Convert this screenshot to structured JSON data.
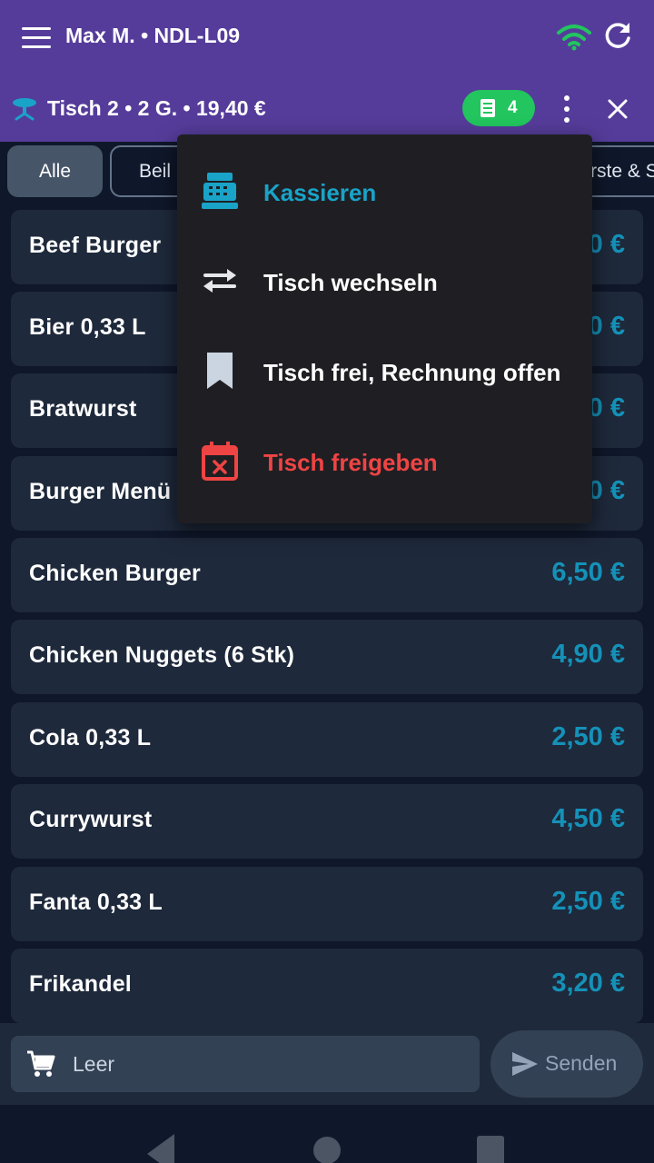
{
  "header": {
    "title": "Max M. • NDL-L09",
    "table_info": "Tisch 2 • 2 G. • 19,40 €",
    "open_orders_count": "4",
    "icons": [
      "menu-icon",
      "wifi-icon",
      "refresh-icon",
      "table-icon",
      "receipt-icon",
      "more-vertical-icon",
      "close-icon"
    ]
  },
  "categories": {
    "items": [
      "Alle",
      "Beil",
      "rste & S"
    ],
    "active": "Alle"
  },
  "products": [
    {
      "name": "Beef Burger",
      "price": "0 €"
    },
    {
      "name": "Bier 0,33 L",
      "price": "0 €"
    },
    {
      "name": "Bratwurst",
      "price": "0 €"
    },
    {
      "name": "Burger Menü",
      "price": "0 €"
    },
    {
      "name": "Chicken Burger",
      "price": "6,50 €"
    },
    {
      "name": "Chicken Nuggets (6 Stk)",
      "price": "4,90 €"
    },
    {
      "name": "Cola 0,33 L",
      "price": "2,50 €"
    },
    {
      "name": "Currywurst",
      "price": "4,50 €"
    },
    {
      "name": "Fanta 0,33 L",
      "price": "2,50 €"
    },
    {
      "name": "Frikandel",
      "price": "3,20 €"
    }
  ],
  "cart": {
    "label": "Leer",
    "send_label": "Senden"
  },
  "menu": {
    "items": [
      {
        "label": "Kassieren",
        "icon": "cash-register-icon",
        "color": "#1aa3c8"
      },
      {
        "label": "Tisch wechseln",
        "icon": "swap-icon",
        "color": "#ffffff"
      },
      {
        "label": "Tisch frei, Rechnung offen",
        "icon": "bookmark-icon",
        "color": "#ffffff"
      },
      {
        "label": "Tisch freigeben",
        "icon": "calendar-remove-icon",
        "color": "#ef4444"
      }
    ]
  },
  "colors": {
    "appbar": "#553c9a",
    "background": "#0f172a",
    "card": "#1e293b",
    "price": "#1591b8",
    "badge": "#22c55e",
    "danger": "#ef4444"
  }
}
